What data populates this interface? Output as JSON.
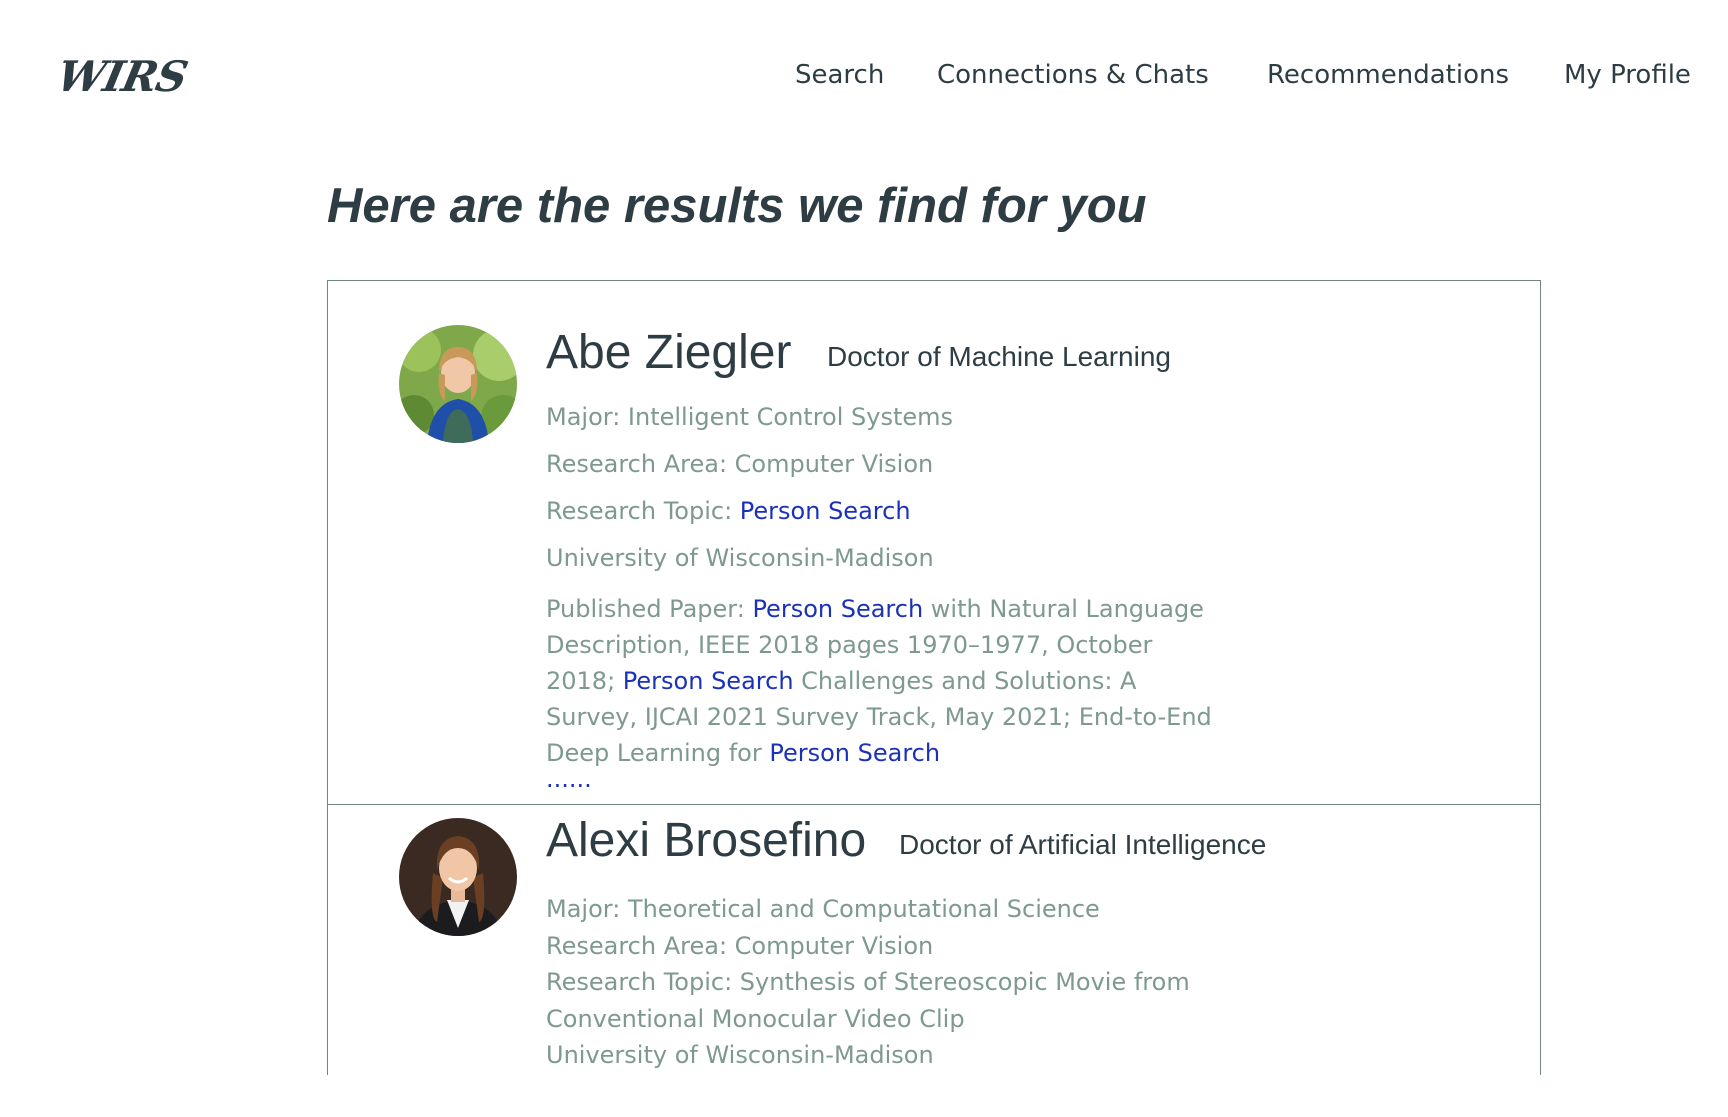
{
  "header": {
    "logo_text": "WIRS",
    "nav": [
      {
        "label": "Search"
      },
      {
        "label": "Connections & Chats"
      },
      {
        "label": "Recommendations"
      },
      {
        "label": "My Profile"
      }
    ]
  },
  "main": {
    "headline": "Here are the results we find for you",
    "results": [
      {
        "name": "Abe Ziegler",
        "degree": "Doctor of Machine Learning",
        "major": "Major: Intelligent Control Systems",
        "research_area": "Research Area: Computer Vision",
        "research_topic_prefix": "Research Topic: ",
        "research_topic": "Person Search",
        "university": "University of Wisconsin-Madison",
        "paper_parts": [
          {
            "text": "Published Paper: ",
            "highlight": false
          },
          {
            "text": "Person Search",
            "highlight": true
          },
          {
            "text": " with Natural Language Description, IEEE 2018 pages 1970–1977, October 2018; ",
            "highlight": false
          },
          {
            "text": "Person Search",
            "highlight": true
          },
          {
            "text": " Challenges and Solutions: A Survey, IJCAI 2021 Survey Track,  May 2021; End-to-End Deep Learning for ",
            "highlight": false
          },
          {
            "text": "Person Search",
            "highlight": true
          }
        ],
        "more": "......"
      },
      {
        "name": "Alexi Brosefino",
        "degree": "Doctor of Artificial Intelligence",
        "major": "Major: Theoretical and Computational Science",
        "research_area": "Research Area: Computer Vision",
        "research_topic": "Research Topic: Synthesis of Stereoscopic Movie from Conventional Monocular Video Clip",
        "university": "University of Wisconsin-Madison"
      }
    ]
  },
  "colors": {
    "text_dark": "#2e3d44",
    "text_muted": "#7e9990",
    "highlight": "#1b32b8",
    "border": "#6f8582"
  }
}
